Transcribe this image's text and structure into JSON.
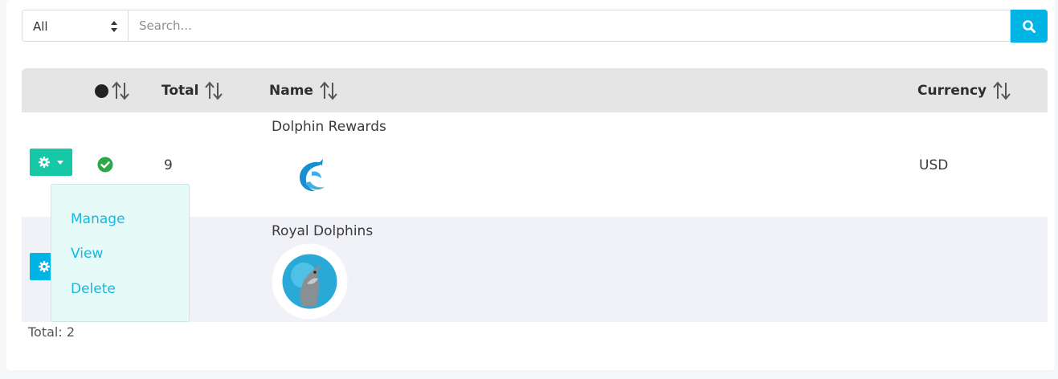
{
  "search": {
    "filter_value": "All",
    "placeholder": "Search..."
  },
  "table": {
    "headers": {
      "total": "Total",
      "name": "Name",
      "currency": "Currency"
    },
    "rows": [
      {
        "total": "9",
        "name": "Dolphin Rewards",
        "currency": "USD",
        "status": "active"
      },
      {
        "total": "",
        "name": "Royal Dolphins",
        "currency": "",
        "status": ""
      }
    ]
  },
  "dropdown": {
    "items": [
      "Manage",
      "View",
      "Delete"
    ]
  },
  "footer": {
    "total_label": "Total: 2"
  },
  "colors": {
    "accent_blue": "#00b4e6",
    "action_green": "#17c8a6",
    "header_bg": "#e5e5e5",
    "link": "#19b6e0"
  }
}
